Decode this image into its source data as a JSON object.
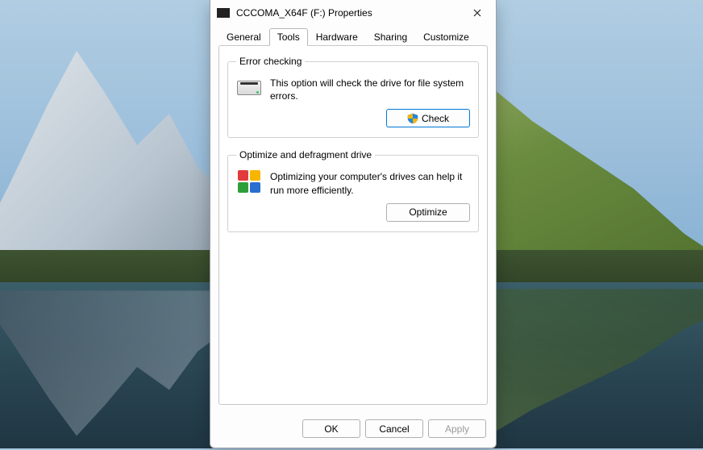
{
  "window": {
    "title": "CCCOMA_X64F (F:) Properties"
  },
  "tabs": {
    "general": "General",
    "tools": "Tools",
    "hardware": "Hardware",
    "sharing": "Sharing",
    "customize": "Customize",
    "active": "tools"
  },
  "error_checking": {
    "legend": "Error checking",
    "description": "This option will check the drive for file system errors.",
    "button": "Check"
  },
  "optimize": {
    "legend": "Optimize and defragment drive",
    "description": "Optimizing your computer's drives can help it run more efficiently.",
    "button": "Optimize"
  },
  "footer": {
    "ok": "OK",
    "cancel": "Cancel",
    "apply": "Apply"
  }
}
